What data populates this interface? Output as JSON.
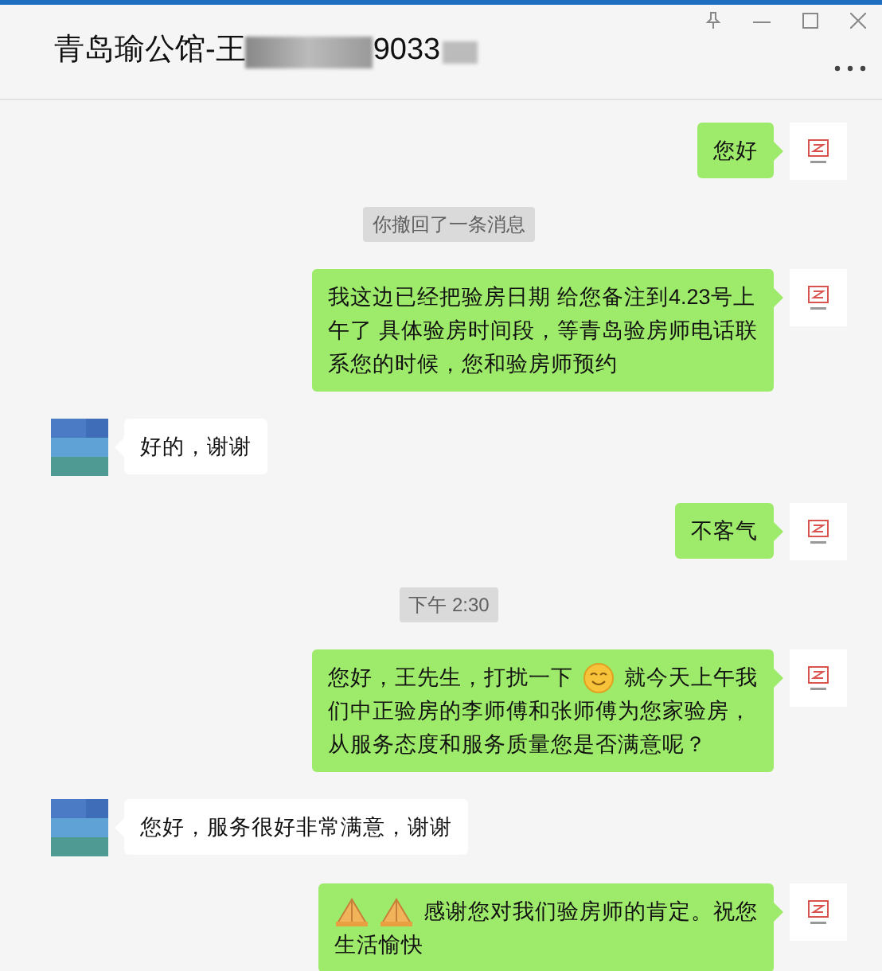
{
  "window": {
    "title_start": "青岛瑜公馆-王",
    "title_end": "9033",
    "redacted": true
  },
  "messages": [
    {
      "kind": "sent",
      "lines": [
        [
          {
            "kind": "text",
            "text": "您好"
          }
        ]
      ]
    },
    {
      "kind": "system",
      "text": "你撤回了一条消息"
    },
    {
      "kind": "sent",
      "lines": [
        [
          {
            "kind": "text",
            "text": "我这边已经把验房日期 给您备注到4.23号上"
          }
        ],
        [
          {
            "kind": "text",
            "text": "午了 具体验房时间段，等青岛验房师电话联"
          }
        ],
        [
          {
            "kind": "text",
            "text": "系您的时候，您和验房师预约"
          }
        ]
      ]
    },
    {
      "kind": "received",
      "lines": [
        [
          {
            "kind": "text",
            "text": "好的，谢谢"
          }
        ]
      ]
    },
    {
      "kind": "sent",
      "lines": [
        [
          {
            "kind": "text",
            "text": "不客气"
          }
        ]
      ]
    },
    {
      "kind": "system",
      "text": "下午 2:30"
    },
    {
      "kind": "sent",
      "lines": [
        [
          {
            "kind": "text",
            "text": "您好，王先生，打扰一下"
          },
          {
            "kind": "smile"
          },
          {
            "kind": "text",
            "text": "就今天上午我"
          }
        ],
        [
          {
            "kind": "text",
            "text": "们中正验房的李师傅和张师傅为您家验房，"
          }
        ],
        [
          {
            "kind": "text",
            "text": "从服务态度和服务质量您是否满意呢？"
          }
        ]
      ]
    },
    {
      "kind": "received",
      "lines": [
        [
          {
            "kind": "text",
            "text": "您好，服务很好非常满意，谢谢"
          }
        ]
      ]
    },
    {
      "kind": "sent",
      "lines": [
        [
          {
            "kind": "hands"
          },
          {
            "kind": "hands"
          },
          {
            "kind": "text",
            "text": "感谢您对我们验房师的肯定。祝您"
          }
        ],
        [
          {
            "kind": "text",
            "text": "生活愉快"
          }
        ]
      ]
    }
  ]
}
